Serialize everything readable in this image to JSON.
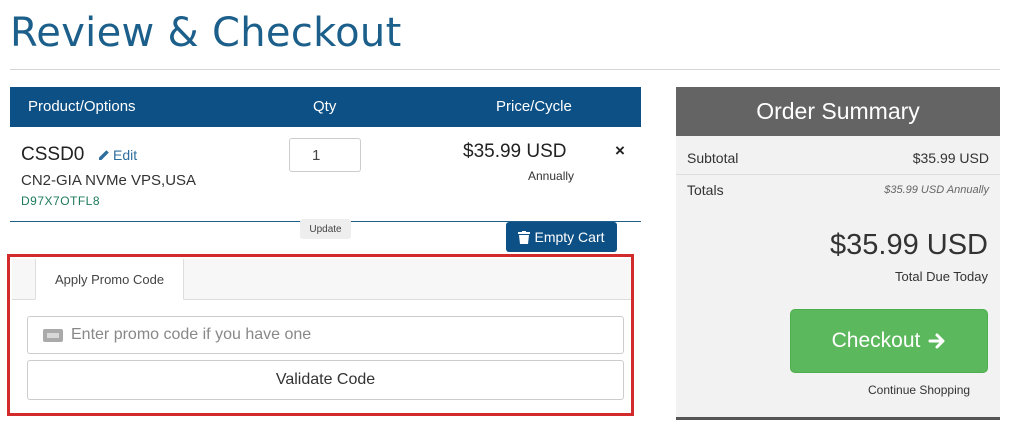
{
  "page": {
    "title": "Review & Checkout"
  },
  "cart": {
    "headers": {
      "product": "Product/Options",
      "qty": "Qty",
      "price": "Price/Cycle"
    },
    "item": {
      "name": "CSSD0",
      "edit_label": "Edit",
      "description": "CN2-GIA NVMe VPS,USA",
      "id": "D97X7OTFL8",
      "qty": "1",
      "update_label": "Update",
      "price": "$35.99 USD",
      "cycle": "Annually",
      "remove": "×"
    },
    "empty_cart_label": "Empty Cart"
  },
  "promo": {
    "tab_label": "Apply Promo Code",
    "placeholder": "Enter promo code if you have one",
    "validate_label": "Validate Code"
  },
  "summary": {
    "title": "Order Summary",
    "subtotal_label": "Subtotal",
    "subtotal_value": "$35.99 USD",
    "totals_label": "Totals",
    "totals_value": "$35.99 USD Annually",
    "total_due": "$35.99 USD",
    "total_due_label": "Total Due Today",
    "checkout_label": "Checkout",
    "continue_label": "Continue Shopping"
  },
  "colors": {
    "brand_blue": "#0d5085",
    "title_blue": "#1b5f8a",
    "summary_header": "#646464",
    "checkout_green": "#5cb85c",
    "highlight_red": "#d22b2b"
  },
  "icons": {
    "edit": "pencil-icon",
    "empty_cart": "trash-icon",
    "promo": "ticket-icon",
    "checkout": "arrow-right-icon",
    "remove": "close-icon"
  }
}
